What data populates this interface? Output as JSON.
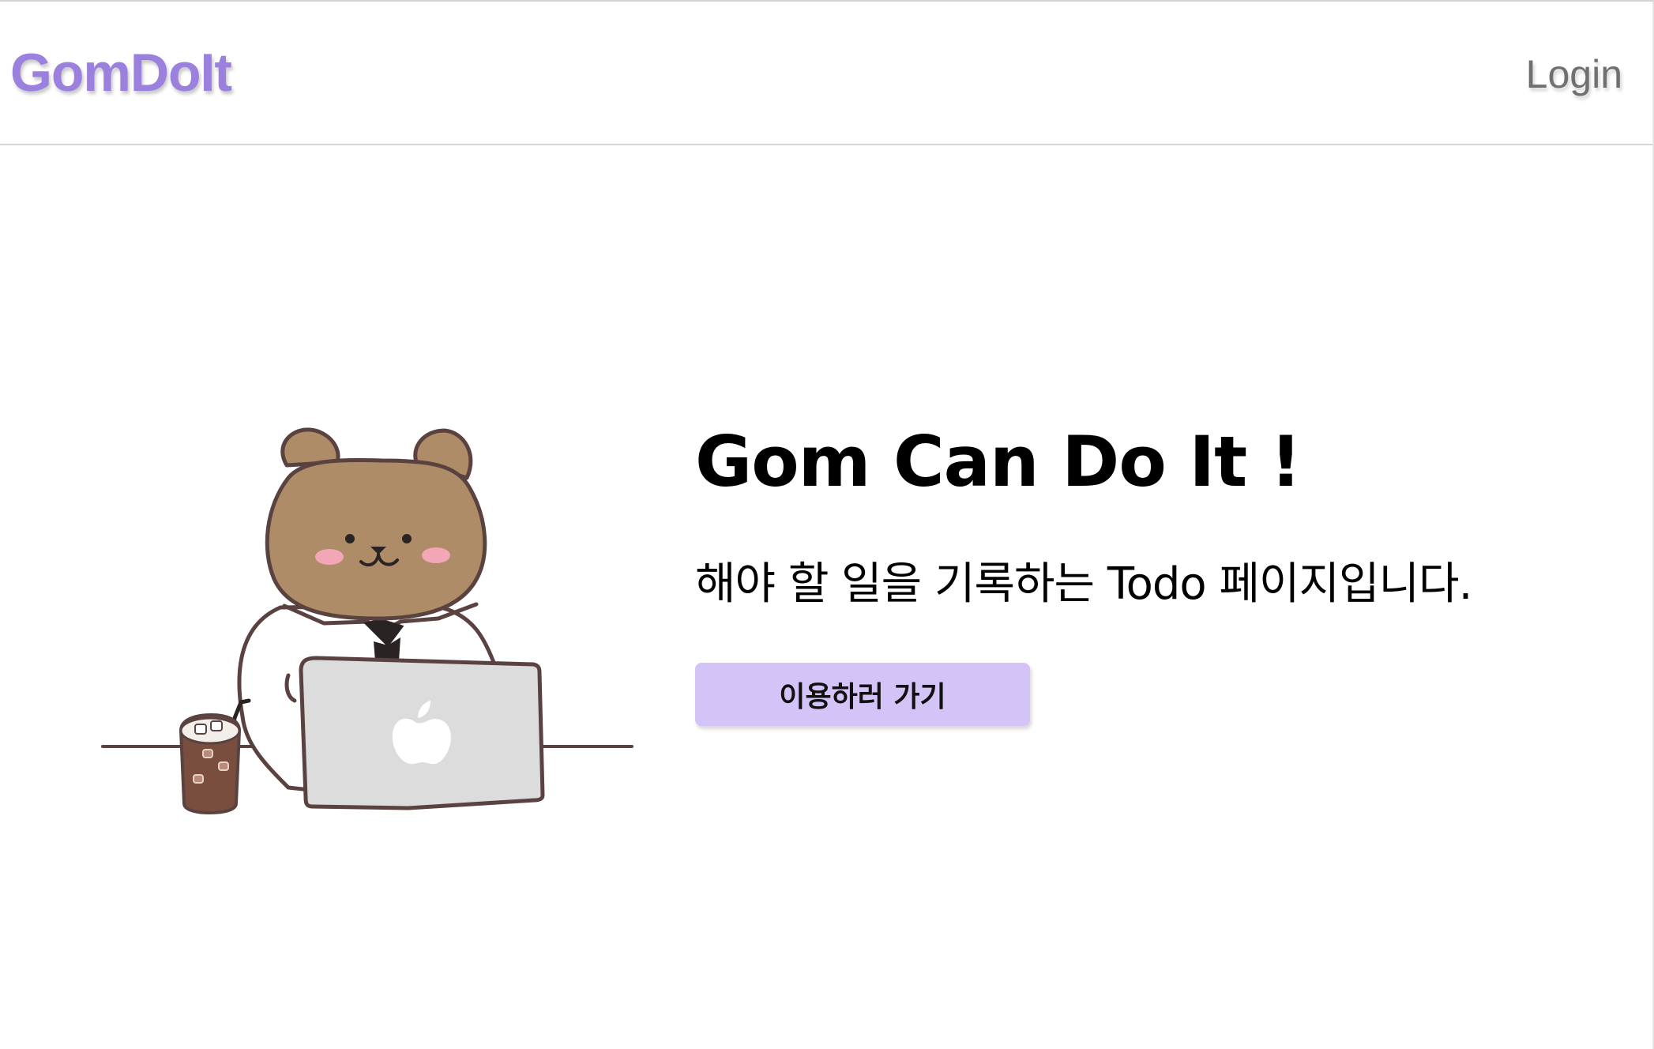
{
  "header": {
    "logo_text": "GomDoIt",
    "login_label": "Login"
  },
  "hero": {
    "title": "Gom Can Do It !",
    "subtitle": "해야 할 일을 기록하는 Todo 페이지입니다.",
    "cta_label": "이용하러 가기",
    "illustration": "bear-working-on-laptop-illustration"
  },
  "colors": {
    "brand": "#9b80dd",
    "button_bg": "#d4c3f6",
    "login_text": "#707070",
    "bear_fur": "#ad8c67",
    "outline": "#5a4240"
  }
}
